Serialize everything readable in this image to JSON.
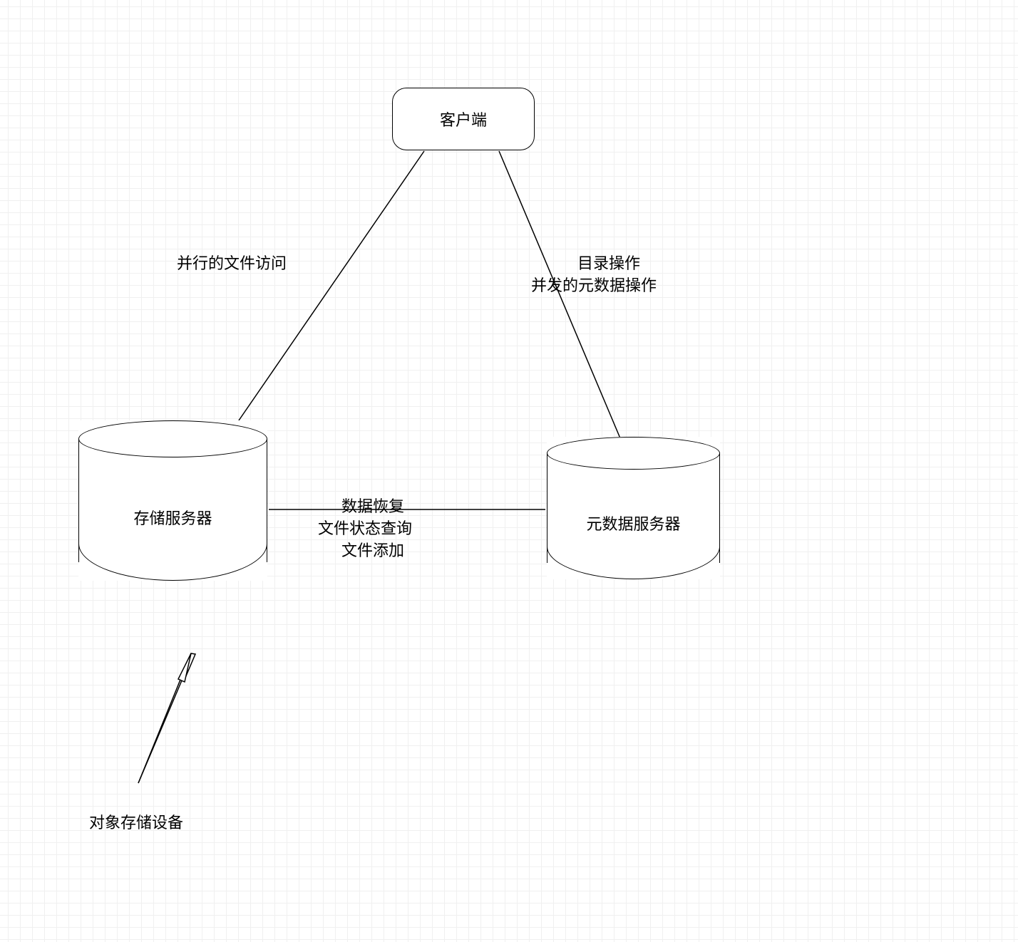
{
  "nodes": {
    "client": {
      "label": "客户端"
    },
    "storage": {
      "label": "存储服务器"
    },
    "metadata": {
      "label": "元数据服务器"
    }
  },
  "edges": {
    "client_storage": {
      "label": "并行的文件访问"
    },
    "client_metadata": {
      "line1": "目录操作",
      "line2": "并发的元数据操作"
    },
    "storage_metadata": {
      "line1": "数据恢复",
      "line2": "文件状态查询",
      "line3": "文件添加"
    }
  },
  "annotations": {
    "osd": {
      "label": "对象存储设备"
    }
  }
}
